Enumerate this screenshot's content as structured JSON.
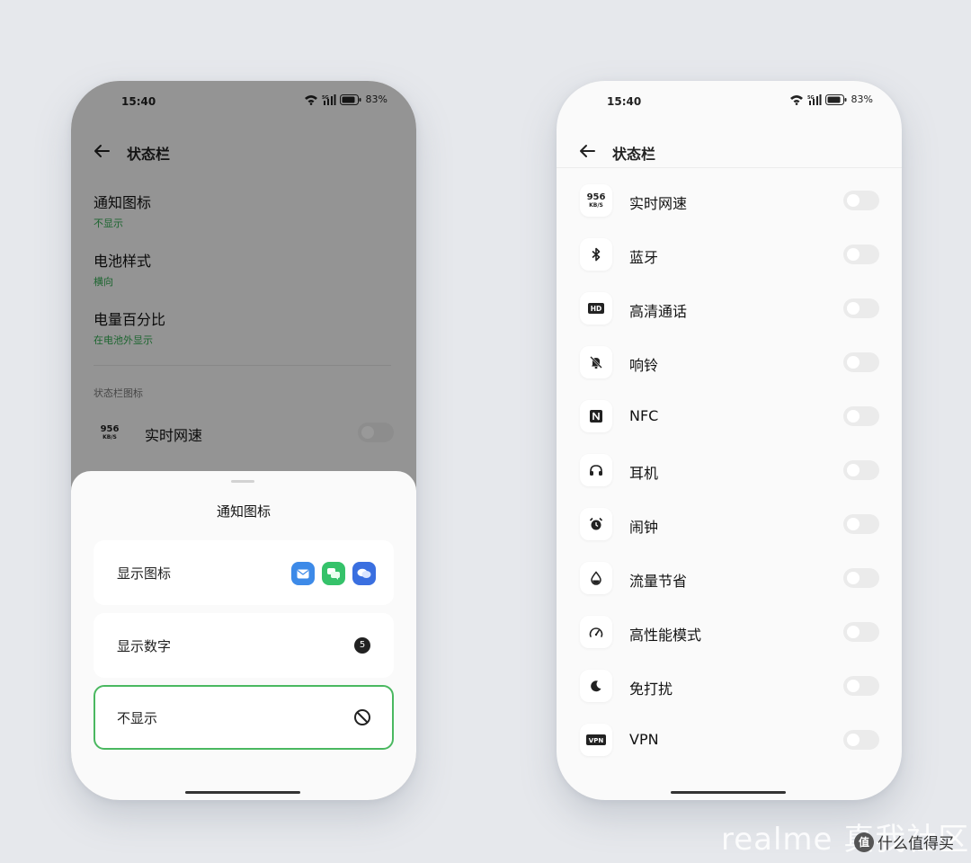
{
  "left_phone": {
    "status": {
      "time": "15:40",
      "battery": "83%"
    },
    "header": {
      "title": "状态栏"
    },
    "settings": [
      {
        "title": "通知图标",
        "subtitle": "不显示"
      },
      {
        "title": "电池样式",
        "subtitle": "横向"
      },
      {
        "title": "电量百分比",
        "subtitle": "在电池外显示"
      }
    ],
    "section_label": "状态栏图标",
    "speed_row": {
      "icon_number": "956",
      "icon_unit": "KB/S",
      "label": "实时网速"
    },
    "sheet": {
      "title": "通知图标",
      "options": [
        {
          "label": "显示图标"
        },
        {
          "label": "显示数字",
          "badge": "5"
        },
        {
          "label": "不显示"
        }
      ]
    }
  },
  "right_phone": {
    "status": {
      "time": "15:40",
      "battery": "83%"
    },
    "header": {
      "title": "状态栏"
    },
    "icon_rows": [
      {
        "label": "实时网速",
        "icon": "network-speed-icon",
        "icon_number": "956",
        "icon_unit": "KB/S"
      },
      {
        "label": "蓝牙",
        "icon": "bluetooth-icon"
      },
      {
        "label": "高清通话",
        "icon": "hd-icon",
        "icon_text": "HD"
      },
      {
        "label": "响铃",
        "icon": "bell-muted-icon"
      },
      {
        "label": "NFC",
        "icon": "nfc-icon"
      },
      {
        "label": "耳机",
        "icon": "headphones-icon"
      },
      {
        "label": "闹钟",
        "icon": "alarm-icon"
      },
      {
        "label": "流量节省",
        "icon": "data-saver-icon"
      },
      {
        "label": "高性能模式",
        "icon": "speedometer-icon"
      },
      {
        "label": "免打扰",
        "icon": "moon-icon"
      },
      {
        "label": "VPN",
        "icon": "vpn-icon",
        "icon_text": "VPN"
      }
    ]
  },
  "watermark": {
    "brand": "realme 真我社区",
    "source": "什么值得买"
  }
}
